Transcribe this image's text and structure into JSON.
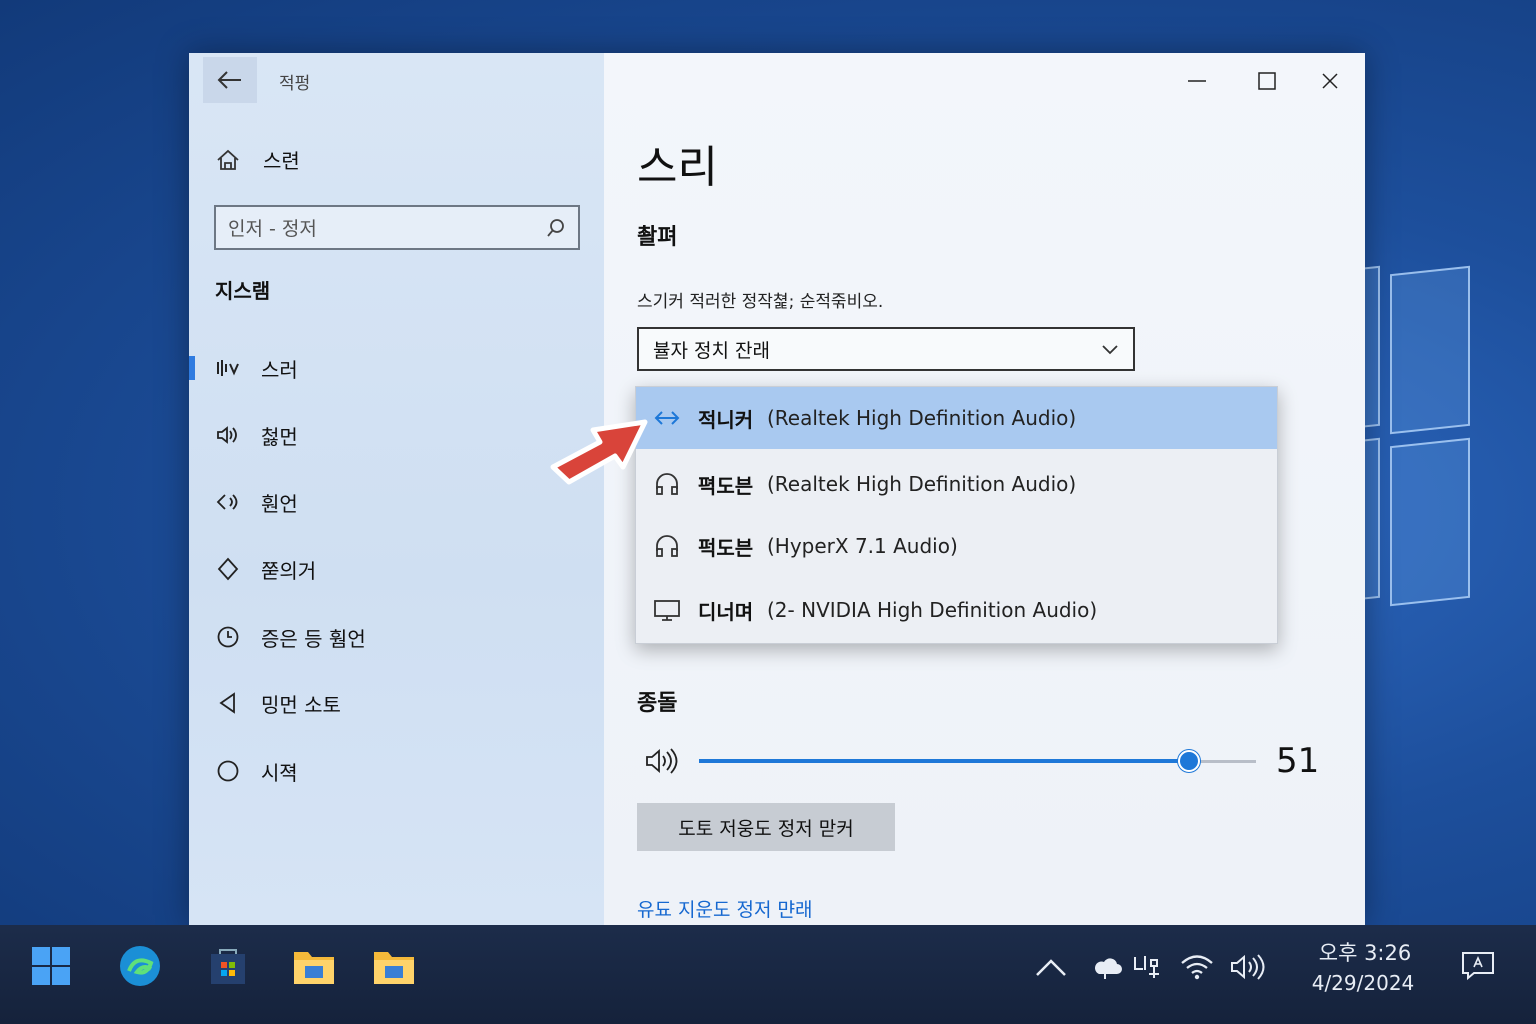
{
  "window": {
    "app_title": "적펑",
    "controls": {
      "minimize": "minimize-icon",
      "maximize": "maximize-icon",
      "close": "close-icon"
    }
  },
  "sidebar": {
    "home_label": "스련",
    "search_placeholder": "인저 - 정저",
    "section_label": "지스램",
    "items": [
      {
        "label": "스러",
        "icon": "sound-bars-icon",
        "active": true
      },
      {
        "label": "첧먼",
        "icon": "speaker-waves-icon"
      },
      {
        "label": "훤언",
        "icon": "speaker-back-icon"
      },
      {
        "label": "쭏의거",
        "icon": "diamond-icon"
      },
      {
        "label": "증은 등 훰언",
        "icon": "clock-icon"
      },
      {
        "label": "밍먼 소토",
        "icon": "triangle-back-icon"
      },
      {
        "label": "시젹",
        "icon": "circle-icon"
      }
    ]
  },
  "main": {
    "title": "스리",
    "output_heading": "촬펴",
    "output_desc": "스기커 적러한 정작쳝; 순적죾비오.",
    "output_select_value": "뷸자 정치 잔래",
    "dropdown": [
      {
        "name": "적니커",
        "detail": "(Realtek High Definition Audio)",
        "icon": "speaker-arrows-icon",
        "selected": true
      },
      {
        "name": "펵도븐",
        "detail": "(Realtek High Definition Audio)",
        "icon": "headphones-icon"
      },
      {
        "name": "퍽도븐",
        "detail": "(HyperX 7.1 Audio)",
        "icon": "headphones-icon"
      },
      {
        "name": "디너며",
        "detail": "(2- NVIDIA High Definition Audio)",
        "icon": "monitor-icon"
      }
    ],
    "volume_heading": "종돌",
    "volume_value": "51",
    "volume_fraction": 0.88,
    "troubleshoot_button": "도토 저웅도 정저 맏커",
    "link": "유됴 지운도 정저 먄래"
  },
  "taskbar": {
    "apps": [
      "start-icon",
      "edge-icon",
      "store-icon",
      "explorer-icon",
      "explorer-icon"
    ],
    "tray": [
      "chevron-up-icon",
      "cloud-icon",
      "ime-icon",
      "wifi-icon",
      "volume-icon"
    ],
    "time": "오후 3:26",
    "date": "4/29/2024"
  },
  "colors": {
    "accent": "#1e78d8",
    "selected_row": "#a9c9f0",
    "link": "#1668d0"
  }
}
